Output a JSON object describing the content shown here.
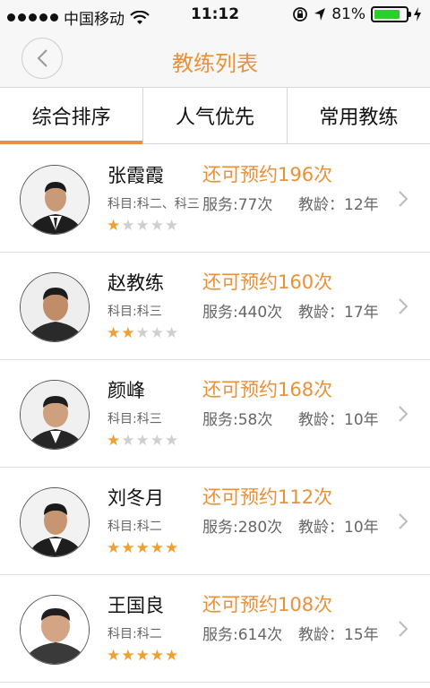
{
  "status_bar": {
    "carrier": "中国移动",
    "time": "11:12",
    "battery": "81%"
  },
  "nav": {
    "title": "教练列表"
  },
  "tabs": [
    {
      "label": "综合排序",
      "active": true
    },
    {
      "label": "人气优先",
      "active": false
    },
    {
      "label": "常用教练",
      "active": false
    }
  ],
  "coaches": [
    {
      "name": "张霞霞",
      "remaining": "还可预约196次",
      "subject": "科目:科二、科三",
      "service": "服务:77次",
      "age": "教龄：12年",
      "rating": 1
    },
    {
      "name": "赵教练",
      "remaining": "还可预约160次",
      "subject": "科目:科三",
      "service": "服务:440次",
      "age": "教龄：17年",
      "rating": 2
    },
    {
      "name": "颜峰",
      "remaining": "还可预约168次",
      "subject": "科目:科三",
      "service": "服务:58次",
      "age": "教龄：10年",
      "rating": 1
    },
    {
      "name": "刘冬月",
      "remaining": "还可预约112次",
      "subject": "科目:科二",
      "service": "服务:280次",
      "age": "教龄：10年",
      "rating": 5
    },
    {
      "name": "王国良",
      "remaining": "还可预约108次",
      "subject": "科目:科二",
      "service": "服务:614次",
      "age": "教龄：15年",
      "rating": 5
    }
  ],
  "colors": {
    "accent": "#e8913a",
    "star_on": "#f0a030",
    "star_off": "#cfcfcf",
    "battery": "#2bd12b"
  }
}
